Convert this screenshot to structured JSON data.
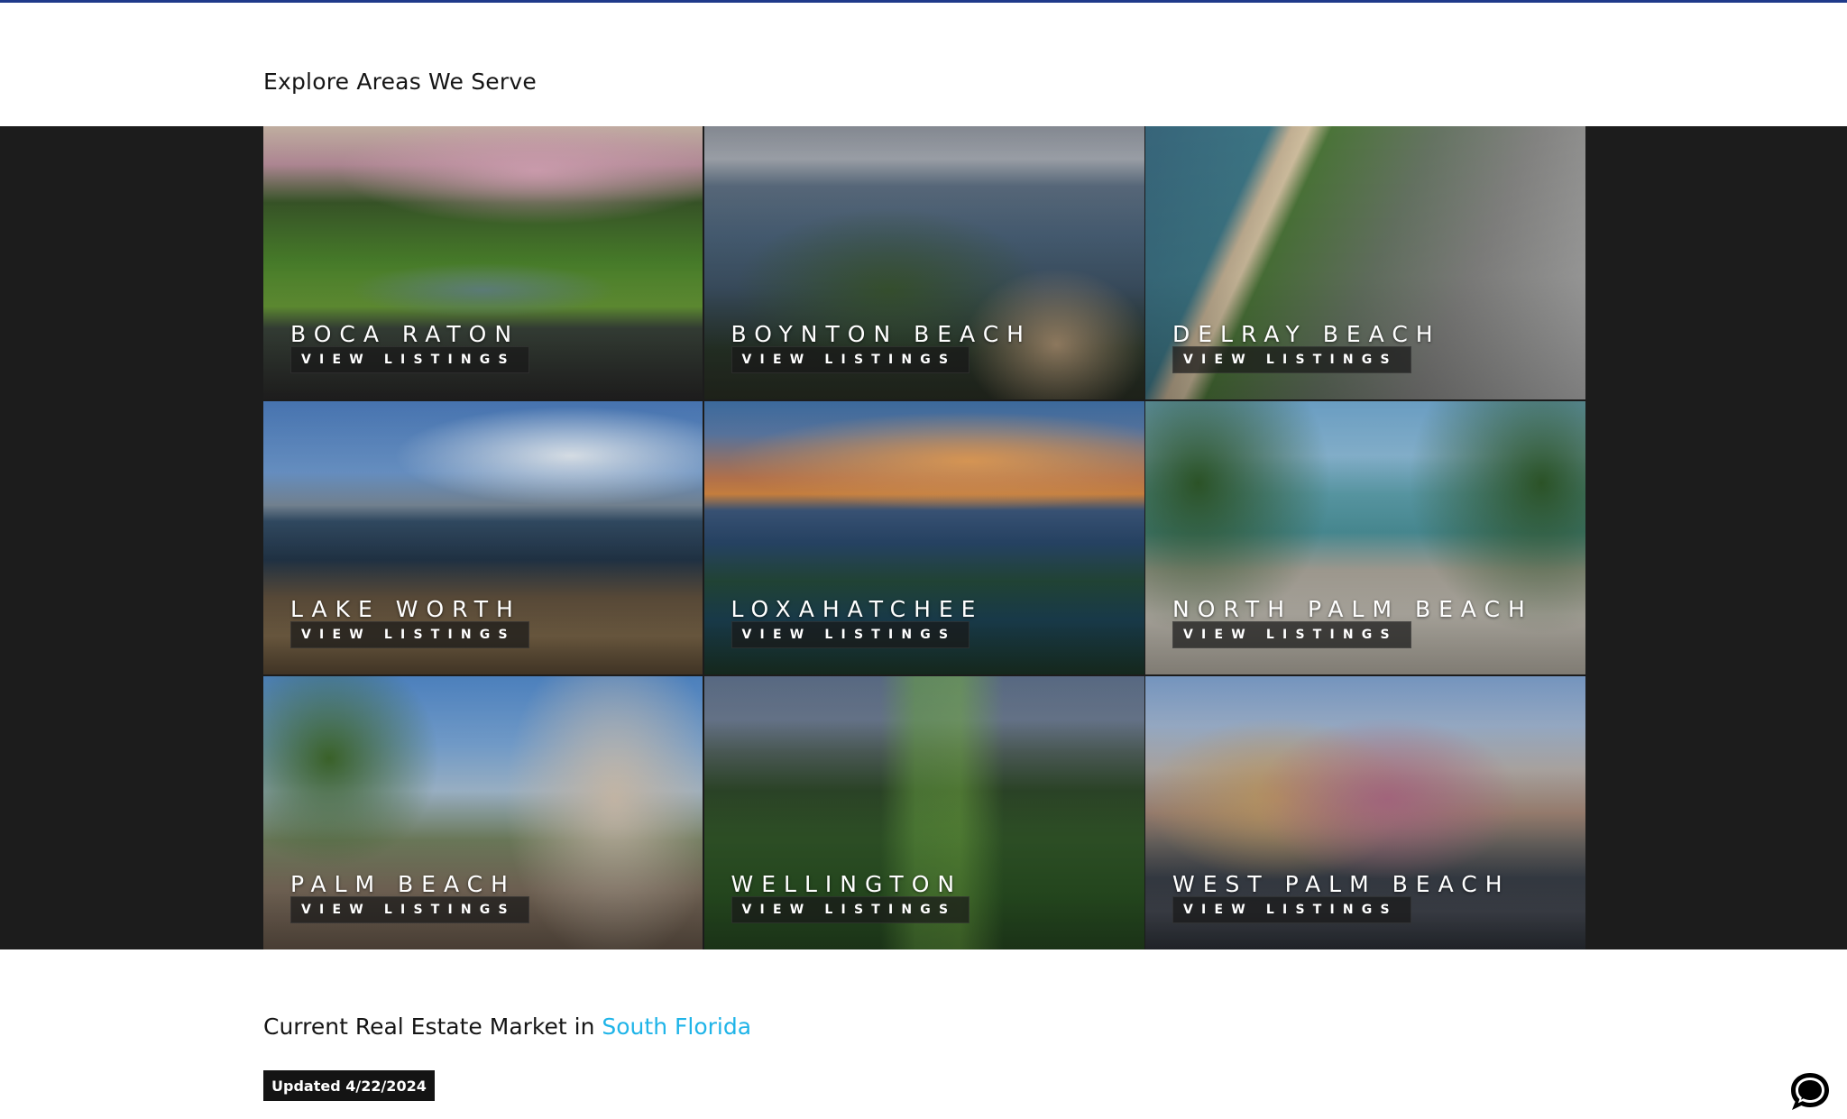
{
  "areas_section": {
    "title": "Explore Areas We Serve",
    "tiles": [
      {
        "name": "BOCA RATON",
        "button": "VIEW LISTINGS"
      },
      {
        "name": "BOYNTON BEACH",
        "button": "VIEW LISTINGS"
      },
      {
        "name": "DELRAY BEACH",
        "button": "VIEW LISTINGS"
      },
      {
        "name": "LAKE WORTH",
        "button": "VIEW LISTINGS"
      },
      {
        "name": "LOXAHATCHEE",
        "button": "VIEW LISTINGS"
      },
      {
        "name": "NORTH PALM BEACH",
        "button": "VIEW LISTINGS"
      },
      {
        "name": "PALM BEACH",
        "button": "VIEW LISTINGS"
      },
      {
        "name": "WELLINGTON",
        "button": "VIEW LISTINGS"
      },
      {
        "name": "WEST PALM BEACH",
        "button": "VIEW LISTINGS"
      }
    ]
  },
  "market_section": {
    "title_prefix": "Current Real Estate Market in",
    "title_region": "South Florida",
    "updated_label": "Updated 4/22/2024"
  },
  "chat": {
    "icon": "chat-bubble-icon"
  },
  "colors": {
    "accent": "#1fb4e8",
    "top_rule": "#1f3a8a",
    "grid_band": "#1c1c1c",
    "badge_bg": "#141414"
  }
}
